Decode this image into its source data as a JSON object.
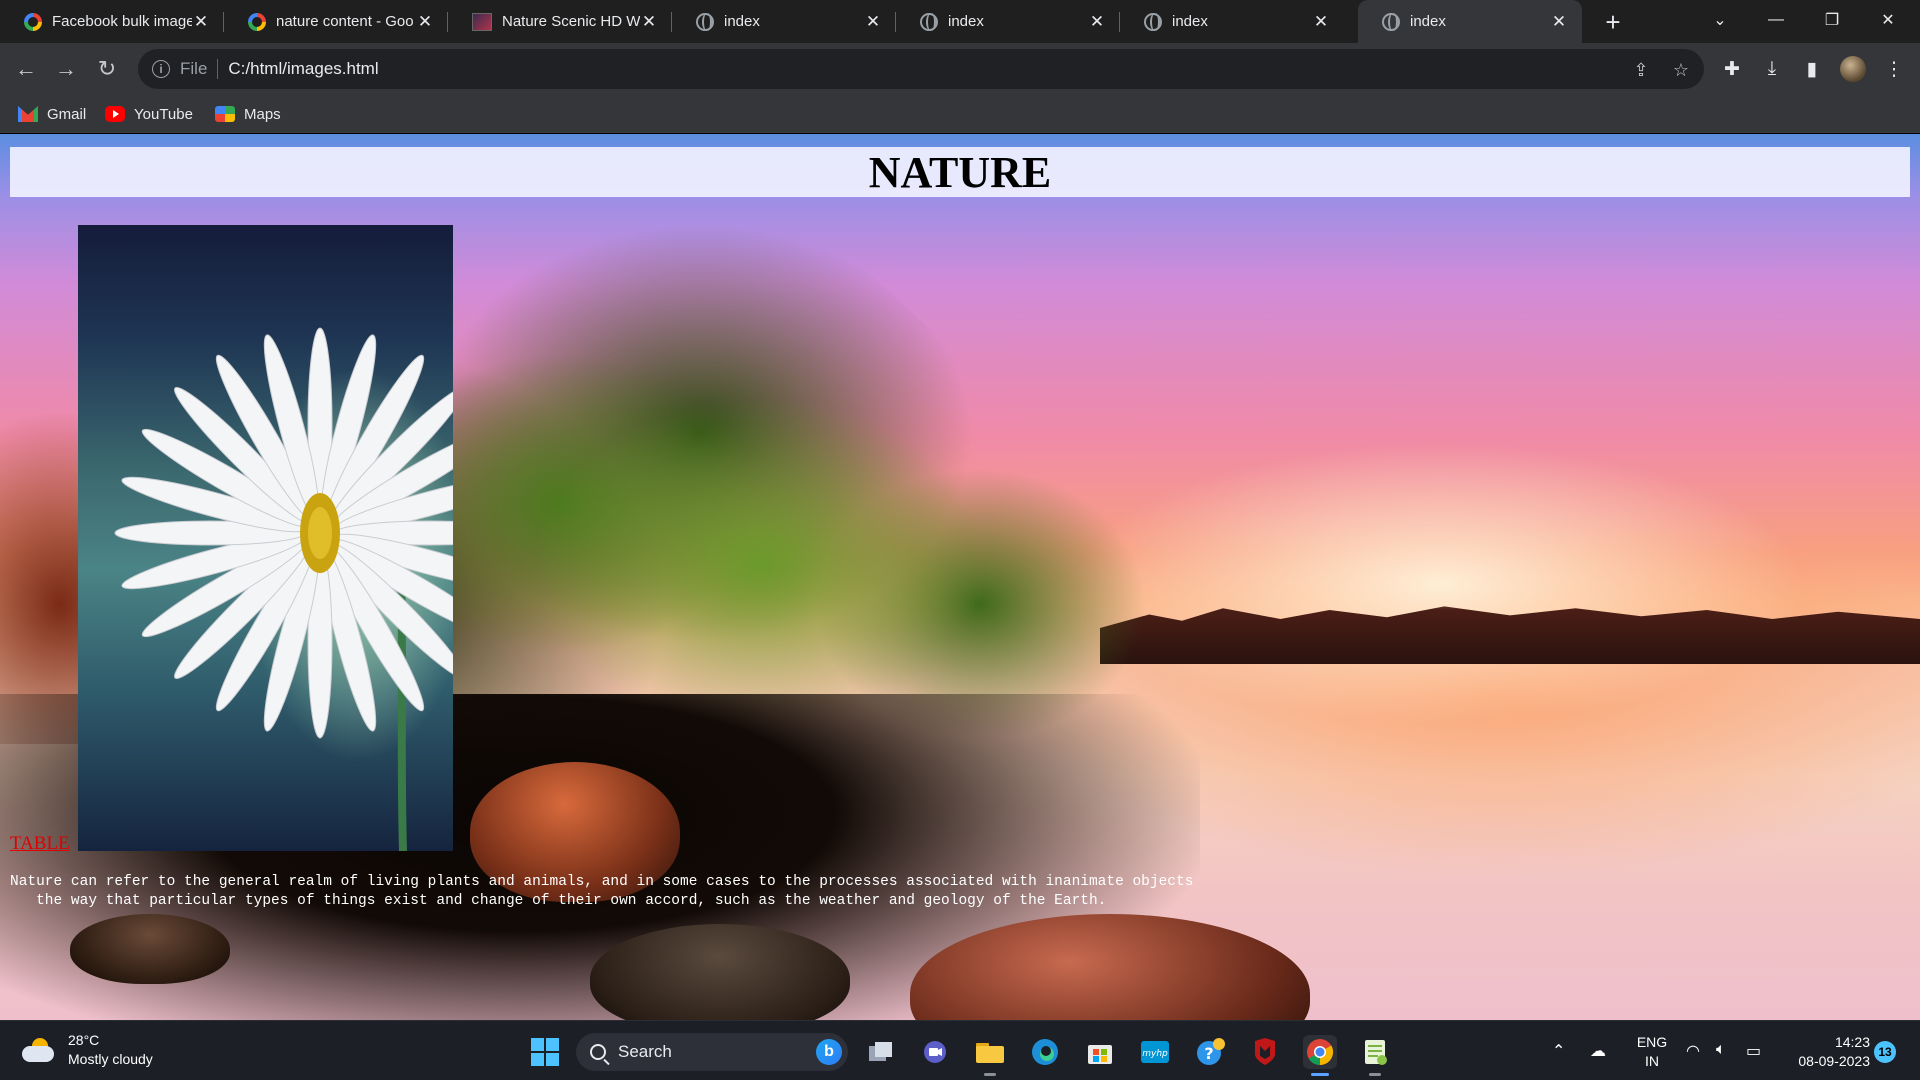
{
  "browser": {
    "tabs": [
      {
        "title": "Facebook bulk image",
        "icon": "google-icon",
        "active": false
      },
      {
        "title": "nature content - Goo",
        "icon": "google-icon",
        "active": false
      },
      {
        "title": "Nature Scenic HD Wa",
        "icon": "image-site-icon",
        "active": false
      },
      {
        "title": "index",
        "icon": "globe-icon",
        "active": false
      },
      {
        "title": "index",
        "icon": "globe-icon",
        "active": false
      },
      {
        "title": "index",
        "icon": "globe-icon",
        "active": false
      },
      {
        "title": "index",
        "icon": "globe-icon",
        "active": true
      }
    ],
    "address": {
      "scheme": "File",
      "url": "C:/html/images.html"
    },
    "bookmarks": [
      {
        "label": "Gmail",
        "icon": "gmail-icon"
      },
      {
        "label": "YouTube",
        "icon": "youtube-icon"
      },
      {
        "label": "Maps",
        "icon": "maps-icon"
      }
    ]
  },
  "page": {
    "heading": "NATURE",
    "link_text": "TABLE",
    "description_line1": "Nature can refer to the general realm of living plants and animals, and in some cases to the processes associated with inanimate objects",
    "description_line2": "   the way that particular types of things exist and change of their own accord, such as the weather and geology of the Earth.",
    "link_color": "#e00000",
    "heading_band_color": "#f0f0ff"
  },
  "taskbar": {
    "weather": {
      "temp": "28°C",
      "condition": "Mostly cloudy"
    },
    "search_placeholder": "Search",
    "language": {
      "line1": "ENG",
      "line2": "IN"
    },
    "clock": {
      "time": "14:23",
      "date": "08-09-2023"
    },
    "notification_count": "13"
  }
}
